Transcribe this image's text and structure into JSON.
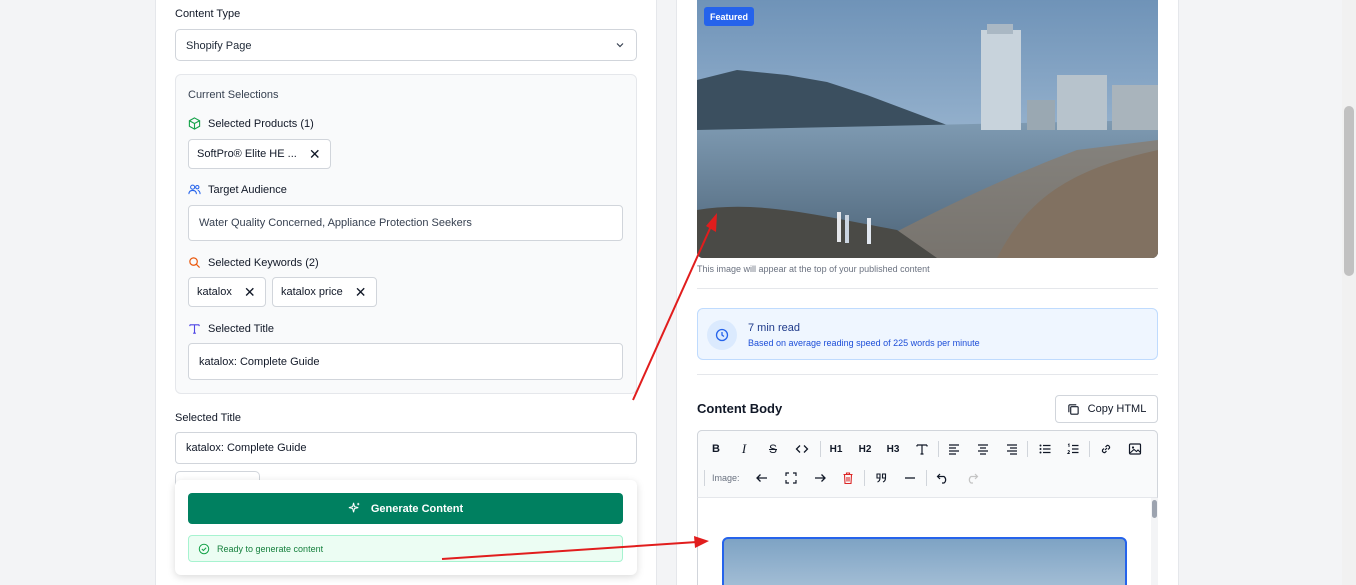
{
  "left": {
    "content_type_label": "Content Type",
    "content_type_value": "Shopify Page",
    "current_selections_title": "Current Selections",
    "selected_products_label": "Selected Products (1)",
    "product_chip": "SoftPro® Elite HE ...",
    "target_audience_label": "Target Audience",
    "target_audience_value": "Water Quality Concerned, Appliance Protection Seekers",
    "selected_keywords_label": "Selected Keywords (2)",
    "keywords": [
      "katalox",
      "katalox price"
    ],
    "selected_title_inner_label": "Selected Title",
    "selected_title_inner_value": "katalox: Complete Guide",
    "selected_title_label": "Selected Title",
    "selected_title_value": "katalox: Complete Guide",
    "generate_button": "Generate Content",
    "ready_status": "Ready to generate content"
  },
  "right": {
    "featured_badge": "Featured",
    "image_note": "This image will appear at the top of your published content",
    "read_time": "7 min read",
    "read_time_note": "Based on average reading speed of 225 words per minute",
    "content_body_title": "Content Body",
    "copy_html_button": "Copy HTML",
    "toolbar": {
      "h1": "H1",
      "h2": "H2",
      "h3": "H3",
      "image_label": "Image:"
    }
  },
  "colors": {
    "primary_green": "#008060",
    "accent_blue": "#2563eb",
    "annotation_red": "#e11d1d"
  }
}
